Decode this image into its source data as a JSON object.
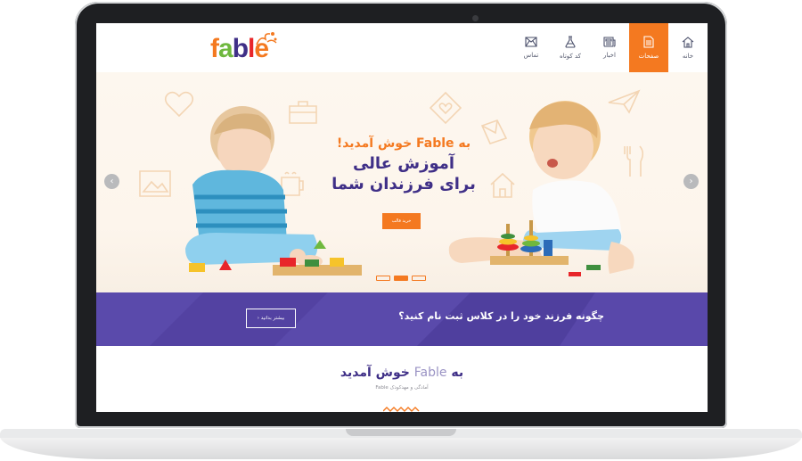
{
  "logo": {
    "text": "fable",
    "letters": [
      "f",
      "a",
      "b",
      "l",
      "e"
    ],
    "colors": [
      "#f47920",
      "#6fb83e",
      "#3f2f87",
      "#e8262a",
      "#f47920"
    ]
  },
  "nav": {
    "items": [
      {
        "label": "خانه",
        "icon": "home-icon"
      },
      {
        "label": "صفحات",
        "icon": "document-icon",
        "active": true
      },
      {
        "label": "اخبار",
        "icon": "news-icon"
      },
      {
        "label": "کد کوتاه",
        "icon": "flask-icon"
      },
      {
        "label": "تماس",
        "icon": "mail-icon"
      }
    ]
  },
  "hero": {
    "line1": "به Fable خوش آمدید!",
    "line2": "آموزش عالی",
    "line3": "برای فرزندان شما",
    "button": "خرید قالب",
    "prev_arrow": "‹",
    "next_arrow": "›",
    "slides": 3,
    "active_slide": 1
  },
  "cta": {
    "text": "چگونه فرزند خود را در کلاس ثبت نام کنید؟",
    "button": "بیشتر بدانید ‹"
  },
  "welcome": {
    "title_prefix": "به",
    "title_brand": "Fable",
    "title_suffix": "خوش آمدید",
    "subtitle": "آمادگی و مهدکودک Fable"
  },
  "colors": {
    "accent": "#f47920",
    "purple": "#5646a6",
    "navy": "#3f2f87"
  }
}
